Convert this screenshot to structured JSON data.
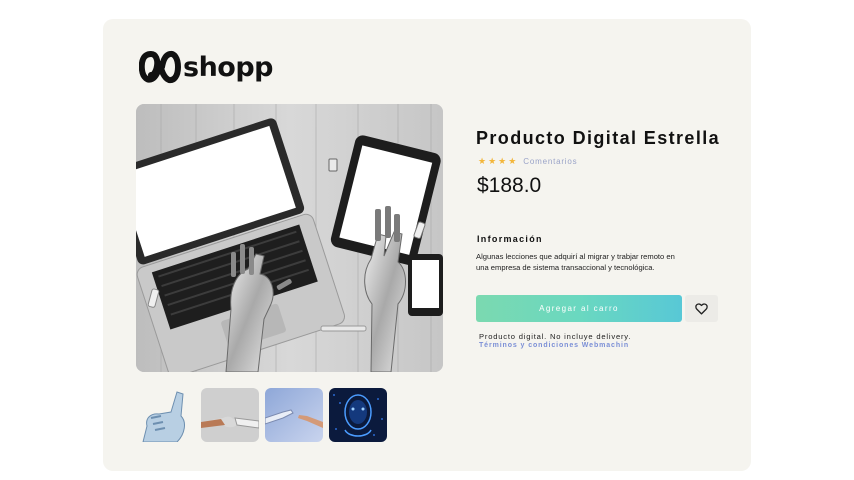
{
  "brand": {
    "name": "shopp"
  },
  "product": {
    "title": "Producto Digital Estrella",
    "rating": 4,
    "rating_max": 4,
    "reviews_label": "Comentarios",
    "price": "$188.0"
  },
  "info": {
    "heading": "Información",
    "text": "Algunas lecciones que adquirí al migrar y trabjar remoto en una empresa de sistema transaccional y tecnológica."
  },
  "actions": {
    "add_to_cart": "Agregar al carro",
    "favorite_icon": "heart-icon"
  },
  "footer": {
    "note": "Producto digital. No incluye delivery.",
    "terms_link": "Términos y condiciones Webmachin"
  },
  "gallery": {
    "main": "laptop-tablet-robot-hands",
    "thumbnails": [
      "robot-hand-pointing",
      "robot-human-handshake",
      "robot-human-fingers",
      "digital-face"
    ]
  },
  "colors": {
    "background": "#ffffff",
    "card": "#f5f4ef",
    "star": "#f3b63a",
    "link": "#7b8fd6",
    "button_gradient_start": "#7bd9b0",
    "button_gradient_end": "#58c8d6"
  }
}
